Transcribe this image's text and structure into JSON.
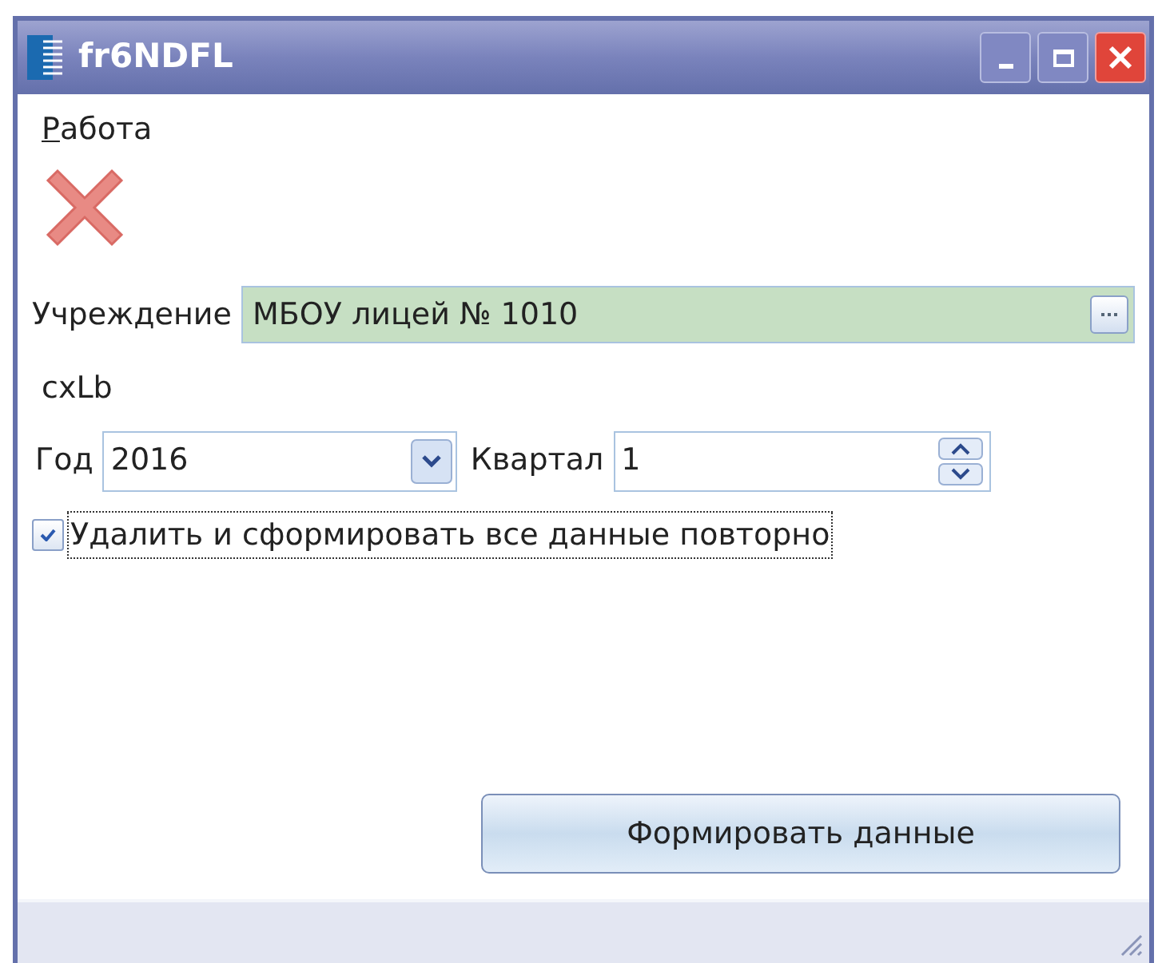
{
  "window": {
    "title": "fr6NDFL"
  },
  "menu": [
    {
      "label": "Работа"
    }
  ],
  "institution": {
    "label": "Учреждение",
    "value": "МБОУ лицей № 1010"
  },
  "caption": "cxLb",
  "year": {
    "label": "Год",
    "value": "2016"
  },
  "quarter": {
    "label": "Квартал",
    "value": "1"
  },
  "recreate": {
    "label": "Удалить и сформировать все данные повторно",
    "checked": true
  },
  "buttons": [
    {
      "label": "Формировать данные"
    }
  ]
}
